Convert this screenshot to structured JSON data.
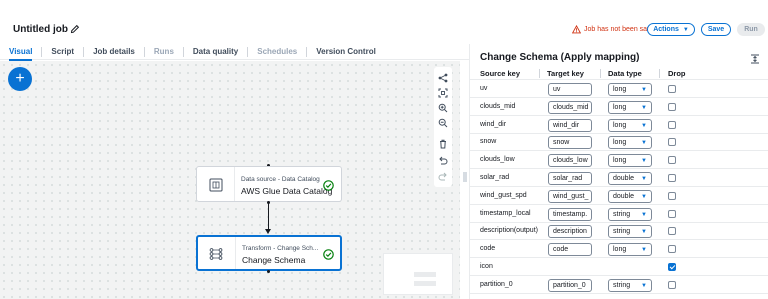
{
  "header": {
    "job_title": "Untitled job",
    "warning": "Job has not been saved",
    "actions_label": "Actions",
    "save_label": "Save",
    "run_label": "Run"
  },
  "tabs": [
    {
      "label": "Visual",
      "state": "active"
    },
    {
      "label": "Script",
      "state": "normal"
    },
    {
      "label": "Job details",
      "state": "normal"
    },
    {
      "label": "Runs",
      "state": "disabled"
    },
    {
      "label": "Data quality",
      "state": "normal"
    },
    {
      "label": "Schedules",
      "state": "disabled"
    },
    {
      "label": "Version Control",
      "state": "normal"
    }
  ],
  "canvas": {
    "add_label": "+",
    "nodes": [
      {
        "sub": "Data source - Data Catalog",
        "name": "AWS Glue Data Catalog",
        "selected": false,
        "icon": "table-icon"
      },
      {
        "sub": "Transform - Change Sch...",
        "name": "Change Schema",
        "selected": true,
        "icon": "schema-icon"
      }
    ]
  },
  "panel": {
    "title": "Change Schema (Apply mapping)",
    "columns": {
      "source": "Source key",
      "target": "Target key",
      "type": "Data type",
      "drop": "Drop"
    },
    "rows": [
      {
        "source": "uv",
        "target": "uv",
        "type": "long",
        "drop": false
      },
      {
        "source": "clouds_mid",
        "target": "clouds_mid",
        "type": "long",
        "drop": false
      },
      {
        "source": "wind_dir",
        "target": "wind_dir",
        "type": "long",
        "drop": false
      },
      {
        "source": "snow",
        "target": "snow",
        "type": "long",
        "drop": false
      },
      {
        "source": "clouds_low",
        "target": "clouds_low",
        "type": "long",
        "drop": false
      },
      {
        "source": "solar_rad",
        "target": "solar_rad",
        "type": "double",
        "drop": false
      },
      {
        "source": "wind_gust_spd",
        "target": "wind_gust_",
        "type": "double",
        "drop": false
      },
      {
        "source": "timestamp_local",
        "target": "timestamp.",
        "type": "string",
        "drop": false
      },
      {
        "source": "description(output)",
        "target": "description",
        "type": "string",
        "drop": false
      },
      {
        "source": "code",
        "target": "code",
        "type": "long",
        "drop": false
      },
      {
        "source": "icon",
        "target": "",
        "type": "",
        "drop": true
      },
      {
        "source": "partition_0",
        "target": "partition_0",
        "type": "string",
        "drop": false
      }
    ]
  },
  "colors": {
    "accent": "#0972d3",
    "warning": "#d13212",
    "success": "#037f0c"
  }
}
